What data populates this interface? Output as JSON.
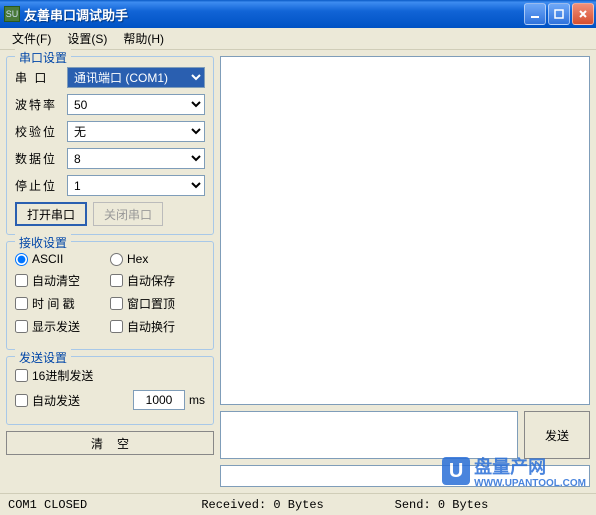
{
  "window": {
    "title": "友善串口调试助手",
    "icon_text": "SU"
  },
  "menu": {
    "file": "文件(F)",
    "settings": "设置(S)",
    "help": "帮助(H)"
  },
  "serial": {
    "title": "串口设置",
    "port_label": "串  口",
    "port_value": "通讯端口 (COM1)",
    "baud_label": "波特率",
    "baud_value": "50",
    "parity_label": "校验位",
    "parity_value": "无",
    "data_label": "数据位",
    "data_value": "8",
    "stop_label": "停止位",
    "stop_value": "1",
    "open_btn": "打开串口",
    "close_btn": "关闭串口"
  },
  "recv": {
    "title": "接收设置",
    "ascii": "ASCII",
    "hex": "Hex",
    "auto_clear": "自动清空",
    "auto_save": "自动保存",
    "timestamp": "时 间 戳",
    "topmost": "窗口置顶",
    "show_send": "显示发送",
    "auto_wrap": "自动换行"
  },
  "send": {
    "title": "发送设置",
    "hex_send": "16进制发送",
    "auto_send": "自动发送",
    "interval": "1000",
    "interval_unit": "ms",
    "clear_btn": "清空",
    "send_btn": "发送"
  },
  "status": {
    "left": "COM1 CLOSED",
    "mid": "Received: 0 Bytes",
    "right": "Send: 0 Bytes"
  },
  "watermark": {
    "big": "盘量产网",
    "sub": "WWW.UPANTOOL.COM"
  }
}
